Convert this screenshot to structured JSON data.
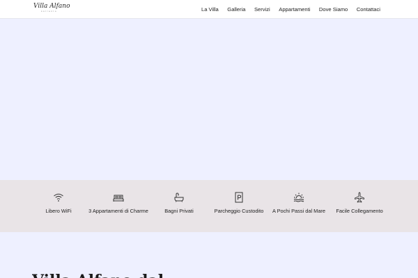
{
  "header": {
    "logo_text": "Villa Alfano",
    "logo_subtext": "sorrento",
    "nav": [
      "La Villa",
      "Galleria",
      "Servizi",
      "Appartamenti",
      "Dove Siamo",
      "Contattaci"
    ]
  },
  "features": [
    {
      "icon": "wifi-icon",
      "label": "Libero WiFi"
    },
    {
      "icon": "bed-icon",
      "label": "3 Appartamenti di Charme"
    },
    {
      "icon": "bathtub-icon",
      "label": "Bagni Privati"
    },
    {
      "icon": "parking-icon",
      "label": "Parcheggio Custodito"
    },
    {
      "icon": "sunset-sea-icon",
      "label": "A Pochi Passi dal Mare"
    },
    {
      "icon": "airplane-icon",
      "label": "Facile Collegamento"
    }
  ],
  "section": {
    "heading_partial": "Villa Alfano dal"
  },
  "colors": {
    "hero_bg": "#eef0ff",
    "features_bg": "#e9e4e7",
    "header_bg": "#ffffff",
    "text": "#222222"
  }
}
